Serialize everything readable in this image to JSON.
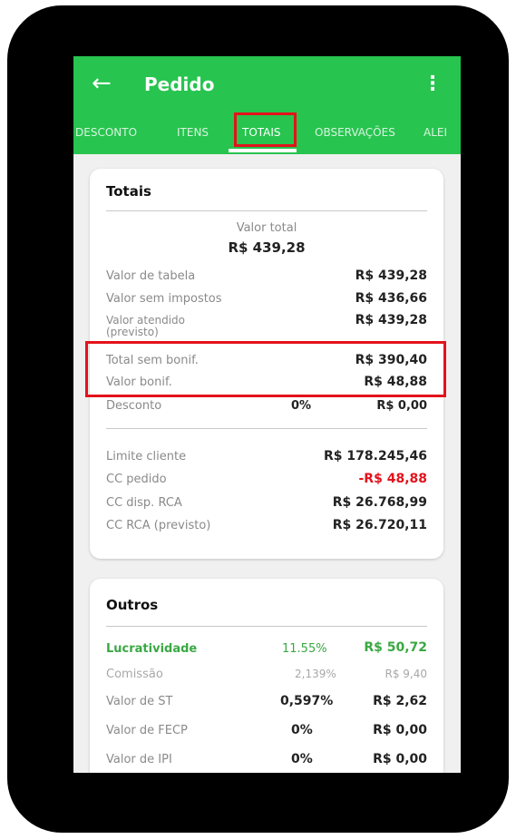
{
  "appbar": {
    "title": "Pedido",
    "back_icon": "←",
    "menu_icon": "⋮"
  },
  "tabs": [
    {
      "label": "DESCONTO"
    },
    {
      "label": "ITENS"
    },
    {
      "label": "TOTAIS",
      "active": true
    },
    {
      "label": "OBSERVAÇÕES"
    },
    {
      "label": "ALEI"
    }
  ],
  "totais": {
    "title": "Totais",
    "valor_total_label": "Valor total",
    "valor_total_value": "R$ 439,28",
    "rows": [
      {
        "label": "Valor de tabela",
        "value": "R$ 439,28"
      },
      {
        "label": "Valor sem impostos",
        "value": "R$ 436,66"
      },
      {
        "label": "Valor atendido\n(previsto)",
        "label_line1": "Valor atendido",
        "label_line2": "(previsto)",
        "value": "R$ 439,28"
      },
      {
        "label": "Total sem bonif.",
        "value": "R$ 390,40"
      },
      {
        "label": "Valor bonif.",
        "value": "R$ 48,88"
      },
      {
        "label": "Desconto",
        "percent": "0%",
        "value": "R$ 0,00"
      }
    ],
    "rows2": [
      {
        "label": "Limite cliente",
        "value": "R$ 178.245,46"
      },
      {
        "label": "CC pedido",
        "value": "-R$ 48,88"
      },
      {
        "label": "CC disp. RCA",
        "value": "R$ 26.768,99"
      },
      {
        "label": "CC RCA (previsto)",
        "value": "R$ 26.720,11"
      }
    ]
  },
  "outros": {
    "title": "Outros",
    "rows": [
      {
        "label": "Lucratividade",
        "percent": "11.55%",
        "value": "R$ 50,72"
      },
      {
        "label": "Comissão",
        "percent": "2,139%",
        "value": "R$ 9,40"
      },
      {
        "label": "Valor de ST",
        "percent": "0,597%",
        "value": "R$ 2,62"
      },
      {
        "label": "Valor de FECP",
        "percent": "0%",
        "value": "R$ 0,00"
      },
      {
        "label": "Valor de IPI",
        "percent": "0%",
        "value": "R$ 0,00"
      }
    ]
  },
  "colors": {
    "brand_green": "#27c44f",
    "negative_red": "#e3121b",
    "profit_green": "#3aa843"
  }
}
